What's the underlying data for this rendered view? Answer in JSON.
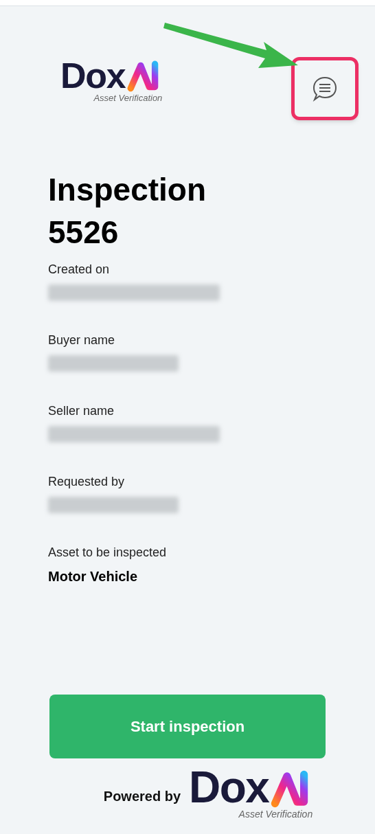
{
  "header": {
    "logo": {
      "wordmark": "Dox",
      "tagline": "Asset Verification"
    },
    "chat_button": {
      "highlighted": true
    }
  },
  "title": "Inspection 5526",
  "fields": [
    {
      "label": "Created on",
      "kind": "redacted"
    },
    {
      "label": "Buyer name",
      "kind": "redacted"
    },
    {
      "label": "Seller name",
      "kind": "redacted"
    },
    {
      "label": "Requested by",
      "kind": "redacted"
    },
    {
      "label": "Asset to be inspected",
      "kind": "text",
      "value": "Motor Vehicle"
    }
  ],
  "start_button": "Start inspection",
  "footer": {
    "powered_by": "Powered by",
    "logo": {
      "wordmark": "Dox",
      "tagline": "Asset Verification"
    }
  }
}
